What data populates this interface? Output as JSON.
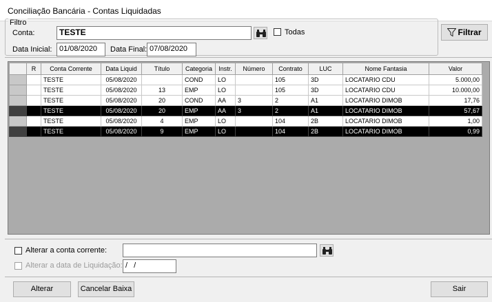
{
  "window": {
    "title": "Conciliação Bancária - Contas Liquidadas"
  },
  "filter": {
    "legend": "Filtro",
    "conta_label": "Conta:",
    "conta_value": "TESTE",
    "todas_label": "Todas",
    "todas_checked": false,
    "data_inicial_label": "Data Inicial:",
    "data_inicial_value": "01/08/2020",
    "data_final_label": "Data Final:",
    "data_final_value": "07/08/2020",
    "filtrar_label": "Filtrar"
  },
  "grid": {
    "columns": [
      "R",
      "Conta Corrente",
      "Data Liquid",
      "Título",
      "Categoria",
      "Instr.",
      "Número",
      "Contrato",
      "LUC",
      "Nome Fantasia",
      "Valor"
    ],
    "rows": [
      {
        "r": "",
        "conta": "TESTE",
        "data": "05/08/2020",
        "titulo": "",
        "categoria": "COND",
        "instr": "LO",
        "numero": "",
        "contrato": "105",
        "luc": "3D",
        "nome": "LOCATARIO CDU",
        "valor": "5.000,00",
        "selected": false
      },
      {
        "r": "",
        "conta": "TESTE",
        "data": "05/08/2020",
        "titulo": "13",
        "categoria": "EMP",
        "instr": "LO",
        "numero": "",
        "contrato": "105",
        "luc": "3D",
        "nome": "LOCATARIO CDU",
        "valor": "10.000,00",
        "selected": false
      },
      {
        "r": "",
        "conta": "TESTE",
        "data": "05/08/2020",
        "titulo": "20",
        "categoria": "COND",
        "instr": "AA",
        "numero": "3",
        "contrato": "2",
        "luc": "A1",
        "nome": "LOCATARIO DIMOB",
        "valor": "17,76",
        "selected": false
      },
      {
        "r": "",
        "conta": "TESTE",
        "data": "05/08/2020",
        "titulo": "20",
        "categoria": "EMP",
        "instr": "AA",
        "numero": "3",
        "contrato": "2",
        "luc": "A1",
        "nome": "LOCATARIO DIMOB",
        "valor": "57,67",
        "selected": true
      },
      {
        "r": "",
        "conta": "TESTE",
        "data": "05/08/2020",
        "titulo": "4",
        "categoria": "EMP",
        "instr": "LO",
        "numero": "",
        "contrato": "104",
        "luc": "2B",
        "nome": "LOCATARIO DIMOB",
        "valor": "1,00",
        "selected": false
      },
      {
        "r": "",
        "conta": "TESTE",
        "data": "05/08/2020",
        "titulo": "9",
        "categoria": "EMP",
        "instr": "LO",
        "numero": "",
        "contrato": "104",
        "luc": "2B",
        "nome": "LOCATARIO DIMOB",
        "valor": "0,99",
        "selected": true
      }
    ]
  },
  "options": {
    "alterar_conta_label": "Alterar a conta corrente:",
    "alterar_conta_value": "",
    "alterar_data_label": "Alterar a data de Liquidação:",
    "alterar_data_value": "/ /"
  },
  "buttons": {
    "alterar": "Alterar",
    "cancelar": "Cancelar Baixa",
    "sair": "Sair"
  }
}
